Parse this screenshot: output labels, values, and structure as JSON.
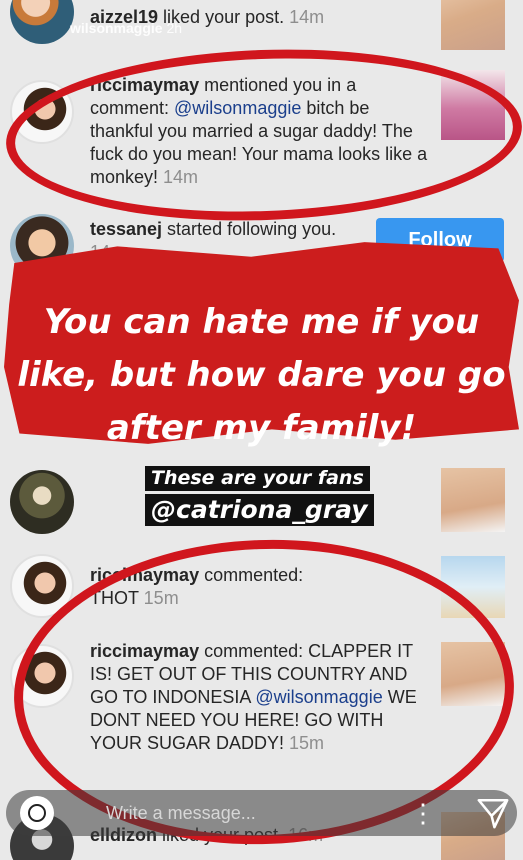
{
  "notifications": [
    {
      "user": "aizzel19",
      "action": " liked your post.",
      "time": " 14m",
      "overlay_user": "wilsonmaggie",
      "overlay_time": "2h"
    },
    {
      "user": "riccimaymay",
      "action": " mentioned you in a comment: ",
      "mention": "@wilsonmaggie",
      "comment": " bitch be thankful you married a sugar daddy! The fuck do you mean! Your mama looks like a monkey!",
      "time": " 14m"
    },
    {
      "user": "tessanej",
      "action": " started following you.",
      "time": " 14m",
      "button": "Follow"
    },
    {
      "user": "riccimaymay",
      "action": " commented: ",
      "comment": "THOT",
      "time": " 15m"
    },
    {
      "user": "riccimaymay",
      "action": " commented: ",
      "comment": "CLAPPER IT IS! GET OUT OF THIS COUNTRY AND GO TO INDONESIA ",
      "mention": "@wilsonmaggie",
      "comment2": " WE DONT NEED YOU HERE! GO WITH YOUR SUGAR DADDY!",
      "time": " 15m"
    },
    {
      "user": "elldizon",
      "action": " liked your post.",
      "time": " 16m"
    }
  ],
  "overlay": {
    "headline": "You can hate me if you like, but how dare you go after my family!",
    "caption_line1": "These are your fans",
    "caption_line2": "@catriona_gray"
  },
  "message_bar": {
    "placeholder": "Write a message..."
  },
  "colors": {
    "overlay_red": "#cc1d1d",
    "circle_red": "#d0161d",
    "follow_blue": "#3897f0",
    "mention_blue": "#1b3f8c"
  },
  "icons": [
    "camera-icon",
    "more-options-icon",
    "send-icon"
  ]
}
